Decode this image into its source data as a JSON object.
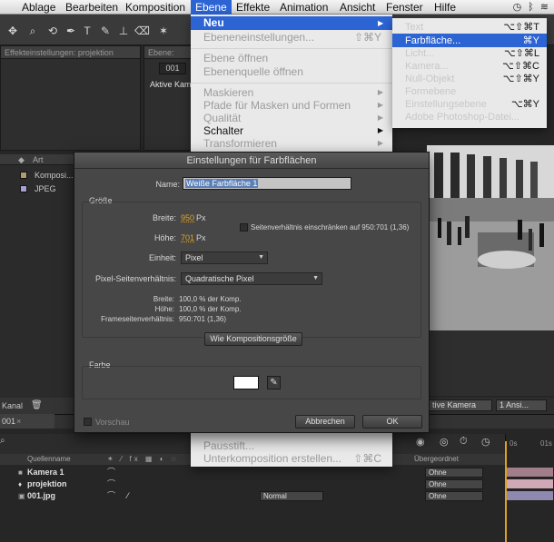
{
  "menubar": {
    "items": [
      "Ablage",
      "Bearbeiten",
      "Komposition",
      "Ebene",
      "Effekte",
      "Animation",
      "Ansicht",
      "Fenster",
      "Hilfe"
    ],
    "active": "Ebene"
  },
  "panels": {
    "effects_tab": "Effekteinstellungen: projektion",
    "ebene_tab": "Ebene:",
    "ebene_field": "001",
    "aktive_kamera": "Aktive Kam",
    "project_col_art": "Art",
    "project_rows": [
      {
        "type": "Komposi...",
        "color": "#b19b6d"
      },
      {
        "type": "JPEG",
        "color": "#a99fcf"
      }
    ],
    "project_bottom_label": "Kanal",
    "preview_camera": "tive Kamera",
    "preview_views": "1 Ansi..."
  },
  "ebene_menu": {
    "items": [
      {
        "label": "Neu",
        "highlighted": true
      },
      {
        "label": "Ebeneneinstellungen...",
        "shortcut": "⇧⌘Y",
        "disabled": true
      },
      {
        "label": "Ebene öffnen",
        "disabled": true
      },
      {
        "label": "Ebenenquelle öffnen",
        "disabled": true
      },
      {
        "label": "Maskieren",
        "disabled": true,
        "submenu": true
      },
      {
        "label": "Pfade für Masken und Formen",
        "disabled": true,
        "submenu": true
      },
      {
        "label": "Qualität",
        "disabled": true,
        "submenu": true
      },
      {
        "label": "Schalter",
        "disabled": false,
        "submenu": true
      },
      {
        "label": "Transformieren",
        "disabled": true,
        "submenu": true
      }
    ],
    "bottom_items": [
      {
        "label": "Pausstift...",
        "disabled": true
      },
      {
        "label": "Unterkomposition erstellen...",
        "shortcut": "⇧⌘C",
        "disabled": true
      }
    ]
  },
  "neu_submenu": {
    "items": [
      {
        "label": "Text",
        "shortcut": "⌥⇧⌘T"
      },
      {
        "label": "Farbfläche...",
        "shortcut": "⌘Y",
        "highlighted": true
      },
      {
        "label": "Licht...",
        "shortcut": "⌥⇧⌘L"
      },
      {
        "label": "Kamera...",
        "shortcut": "⌥⇧⌘C"
      },
      {
        "label": "Null-Objekt",
        "shortcut": "⌥⇧⌘Y"
      },
      {
        "label": "Formebene",
        "shortcut": ""
      },
      {
        "label": "Einstellungsebene",
        "shortcut": "⌥⌘Y"
      },
      {
        "label": "Adobe Photoshop-Datei...",
        "shortcut": ""
      }
    ]
  },
  "dialog": {
    "title": "Einstellungen für Farbflächen",
    "name_label": "Name:",
    "name_value": "Weiße Farbfläche 1",
    "size_group": "Größe",
    "width_label": "Breite:",
    "width_value": "950",
    "width_unit": "Px",
    "height_label": "Höhe:",
    "height_value": "701",
    "height_unit": "Px",
    "aspect_lock": "Seitenverhältnis einschränken auf 950:701 (1,36)",
    "unit_label": "Einheit:",
    "unit_value": "Pixel",
    "pixel_aspect_label": "Pixel-Seitenverhältnis:",
    "pixel_aspect_value": "Quadratische Pixel",
    "info_width_label": "Breite:",
    "info_width_value": "100,0 % der Komp.",
    "info_height_label": "Höhe:",
    "info_height_value": "100,0 % der Komp.",
    "info_frame_label": "Frameseitenverhältnis:",
    "info_frame_value": "950:701 (1,36)",
    "comp_size_button": "Wie Kompositionsgröße",
    "color_group": "Farbe",
    "color_value": "#ffffff",
    "preview_label": "Vorschau",
    "cancel_button": "Abbrechen",
    "ok_button": "OK"
  },
  "timeline": {
    "tab": "001",
    "col_source": "Quellenname",
    "col_parent": "Übergeordnet",
    "ruler_label": "0s",
    "rows": [
      {
        "num": "1",
        "name": "Kamera 1",
        "parent": "Ohne",
        "mode": ""
      },
      {
        "num": "2",
        "name": "projektion",
        "parent": "Ohne",
        "mode": ""
      },
      {
        "num": "3",
        "name": "001.jpg",
        "parent": "Ohne",
        "mode": "Normal"
      }
    ]
  }
}
